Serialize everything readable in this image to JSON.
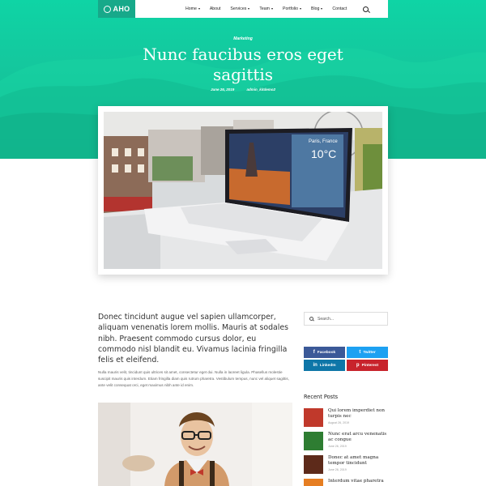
{
  "brand": {
    "name": "AHO"
  },
  "nav": {
    "items": [
      {
        "label": "Home",
        "dropdown": true
      },
      {
        "label": "About",
        "dropdown": false
      },
      {
        "label": "Services",
        "dropdown": true
      },
      {
        "label": "Team",
        "dropdown": true
      },
      {
        "label": "Portfolio",
        "dropdown": true
      },
      {
        "label": "Blog",
        "dropdown": true
      },
      {
        "label": "Contact",
        "dropdown": false
      }
    ]
  },
  "post": {
    "category": "Marketing",
    "title": "Nunc faucibus eros eget sagittis",
    "date": "June 26, 2019",
    "author": "admin_kitdemo2",
    "lead": "Donec tincidunt augue vel sapien ullamcorper, aliquam venenatis lorem mollis. Mauris at sodales nibh. Praesent commodo cursus dolor, eu commodo nisl blandit eu. Vivamus lacinia fringilla felis et eleifend.",
    "body": "Nulla mauris velit, tincidunt quis ultrices sit amet, consectetur eget dui. Nulla in laoreet ligula. Phasellus molestie suscipit mauris quis interdum. Etiam fringilla diam quis rutrum pharetra. Vestibulum tempus, nunc vel aliquet sagittis, ante velit consequat orci, eget maximus nibh ante id enim."
  },
  "laptop_screen": {
    "city": "Paris, France",
    "temp": "10°C"
  },
  "sidebar": {
    "search_placeholder": "Search...",
    "social": [
      {
        "label": "Facebook",
        "icon": "f",
        "color": "#3b5998"
      },
      {
        "label": "Twitter",
        "icon": "t",
        "color": "#1da1f2"
      },
      {
        "label": "LinkedIn",
        "icon": "in",
        "color": "#0e76a8"
      },
      {
        "label": "Pinterest",
        "icon": "p",
        "color": "#c8232c"
      }
    ],
    "recent_title": "Recent Posts",
    "recent": [
      {
        "title": "Qui lorem imperdiet non turpis nec",
        "date": "August 26, 2019",
        "thumb": "#c0392b"
      },
      {
        "title": "Nunc erat arcu venenatis ac congue",
        "date": "June 26, 2019",
        "thumb": "#2e7d32"
      },
      {
        "title": "Donec at amet magna tempor tincidunt",
        "date": "June 26, 2019",
        "thumb": "#5d2a1a"
      },
      {
        "title": "Interdum vitae pharetra",
        "date": "",
        "thumb": "#e67e22"
      }
    ]
  },
  "colors": {
    "accent": "#17c99b",
    "logo_bg": "#17a98a"
  }
}
